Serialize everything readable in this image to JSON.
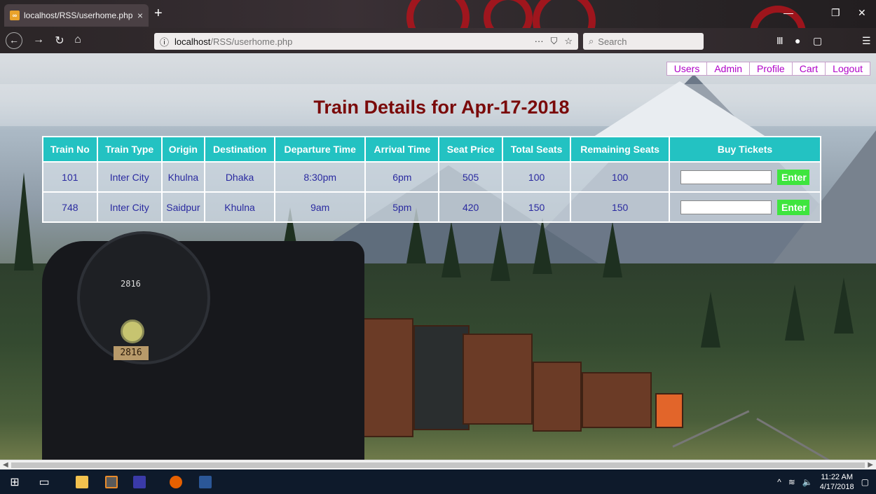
{
  "browser": {
    "tab_title": "localhost/RSS/userhome.php",
    "tab_close": "×",
    "new_tab": "+",
    "url_host": "localhost",
    "url_path": "/RSS/userhome.php",
    "url_info": "ⓘ",
    "url_more": "···",
    "search_placeholder": "Search"
  },
  "nav_links": [
    "Users",
    "Admin",
    "Profile",
    "Cart",
    "Logout"
  ],
  "page_title": "Train Details for Apr-17-2018",
  "table": {
    "headers": [
      "Train No",
      "Train Type",
      "Origin",
      "Destination",
      "Departure Time",
      "Arrival Time",
      "Seat Price",
      "Total Seats",
      "Remaining Seats",
      "Buy Tickets"
    ],
    "rows": [
      [
        "101",
        "Inter City",
        "Khulna",
        "Dhaka",
        "8:30pm",
        "6pm",
        "505",
        "100",
        "100"
      ],
      [
        "748",
        "Inter City",
        "Saidpur",
        "Khulna",
        "9am",
        "5pm",
        "420",
        "150",
        "150"
      ]
    ],
    "enter_label": "Enter"
  },
  "scene": {
    "loco_number": "2816",
    "loco_plate": "2816"
  },
  "taskbar": {
    "time": "11:22 AM",
    "date": "4/17/2018"
  },
  "colors": {
    "header_bg": "#23c2c2",
    "title": "#7a0a0a",
    "link": "#b000c8",
    "enter_btn": "#3ee53e"
  }
}
